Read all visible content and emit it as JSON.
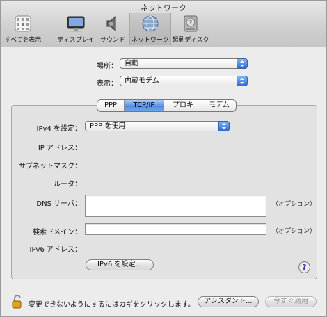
{
  "window": {
    "title": "ネットワーク"
  },
  "toolbar": {
    "items": [
      {
        "label": "すべてを表示",
        "icon": "apple-logo-icon"
      },
      {
        "label": "ディスプレイ",
        "icon": "display-icon"
      },
      {
        "label": "サウンド",
        "icon": "speaker-icon"
      },
      {
        "label": "ネットワーク",
        "icon": "network-globe-icon"
      },
      {
        "label": "起動ディスク",
        "icon": "startup-disk-icon"
      }
    ]
  },
  "location": {
    "label": "場所：",
    "value": "自動"
  },
  "show": {
    "label": "表示：",
    "value": "内蔵モデム"
  },
  "tabs": {
    "items": [
      "PPP",
      "TCP/IP",
      "プロキシ",
      "モデム"
    ],
    "selected": "TCP/IP"
  },
  "ipv4": {
    "label": "IPv4 を設定：",
    "value": "PPP を使用"
  },
  "fields": {
    "ip_address": "IP アドレス：",
    "subnet_mask": "サブネットマスク：",
    "router": "ルータ：",
    "dns_label": "DNS サーバ：",
    "dns_value": "",
    "dns_optional": "（オプション）",
    "search_domain_label": "検索ドメイン：",
    "search_domain_value": "",
    "search_optional": "（オプション）",
    "ipv6_address": "IPv6 アドレス："
  },
  "buttons": {
    "ipv6_config": "IPv6 を設定...",
    "help": "?",
    "assistant": "アシスタント...",
    "apply_now": "今すぐ適用"
  },
  "footer": {
    "lock_text": "変更できないようにするにはカギをクリックします。"
  },
  "colors": {
    "accent": "#4e8de3",
    "lock": "#e0a020"
  }
}
